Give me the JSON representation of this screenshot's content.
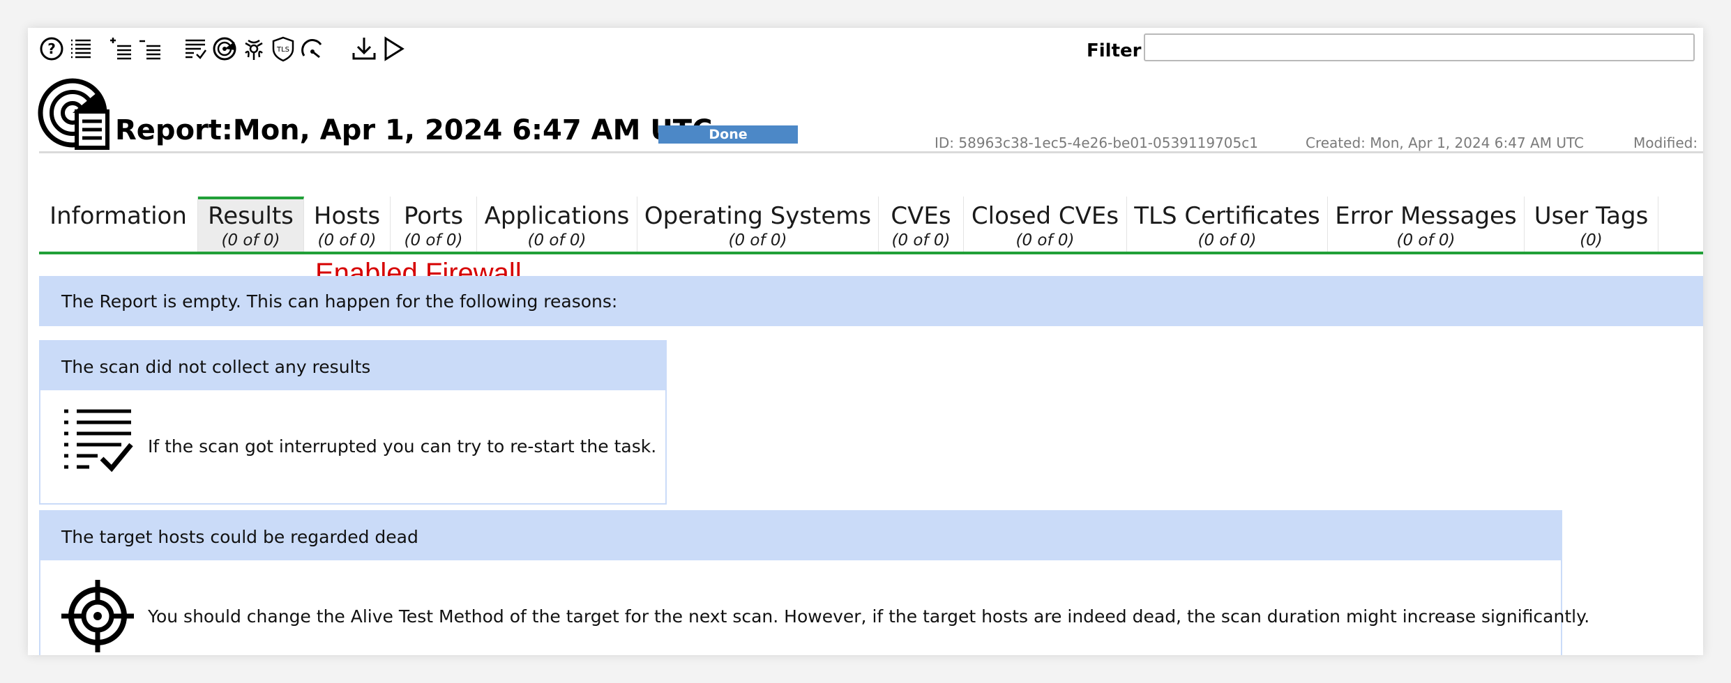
{
  "toolbar": {
    "icons": [
      "help-icon",
      "list-icon",
      "add-list-icon",
      "remove-list-icon",
      "results-list-icon",
      "hosts-icon",
      "vulnerabilities-icon",
      "tls-icon",
      "performance-icon",
      "download-icon",
      "start-icon"
    ]
  },
  "filter": {
    "label": "Filter",
    "value": ""
  },
  "report": {
    "title": "Report:Mon, Apr 1, 2024 6:47 AM UTC",
    "status": "Done",
    "status_color": "#4c88c7",
    "id": "ID: 58963c38-1ec5-4e26-be01-0539119705c1",
    "created": "Created: Mon, Apr 1, 2024 6:47 AM UTC",
    "modified": "Modified: M"
  },
  "tabs": [
    {
      "label": "Information",
      "count": ""
    },
    {
      "label": "Results",
      "count": "(0 of 0)",
      "active": true
    },
    {
      "label": "Hosts",
      "count": "(0 of 0)"
    },
    {
      "label": "Ports",
      "count": "(0 of 0)"
    },
    {
      "label": "Applications",
      "count": "(0 of 0)"
    },
    {
      "label": "Operating Systems",
      "count": "(0 of 0)"
    },
    {
      "label": "CVEs",
      "count": "(0 of 0)"
    },
    {
      "label": "Closed CVEs",
      "count": "(0 of 0)"
    },
    {
      "label": "TLS Certificates",
      "count": "(0 of 0)"
    },
    {
      "label": "Error Messages",
      "count": "(0 of 0)"
    },
    {
      "label": "User Tags",
      "count": "(0)"
    }
  ],
  "annotation": "Enabled Firewall",
  "empty": {
    "banner": "The Report is empty. This can happen for the following reasons:",
    "reasons": [
      {
        "title": "The scan did not collect any results",
        "icon": "task-list-icon",
        "text": "If the scan got interrupted you can try to re-start the task."
      },
      {
        "title": "The target hosts could be regarded dead",
        "icon": "target-icon",
        "text": "You should change the Alive Test Method of the target for the next scan. However, if the target hosts are indeed dead, the scan duration might increase significantly."
      }
    ]
  },
  "colors": {
    "accent_green": "#21a038",
    "panel_blue": "#cadbf8",
    "annotation_red": "#d60000"
  }
}
